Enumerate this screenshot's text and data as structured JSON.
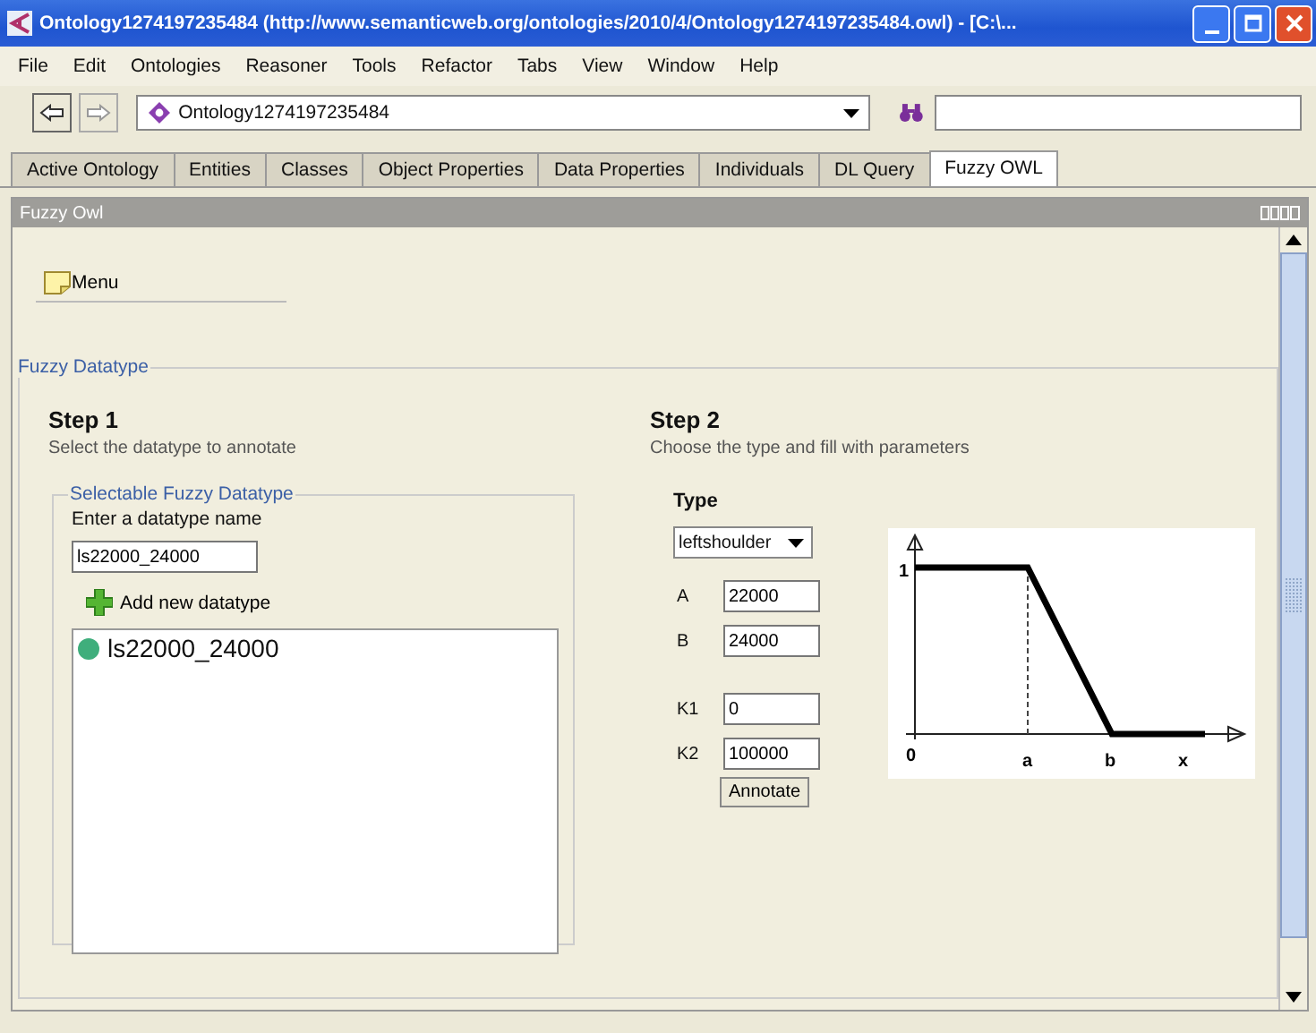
{
  "window": {
    "title": "Ontology1274197235484 (http://www.semanticweb.org/ontologies/2010/4/Ontology1274197235484.owl) - [C:\\..."
  },
  "menu_bar": [
    "File",
    "Edit",
    "Ontologies",
    "Reasoner",
    "Tools",
    "Refactor",
    "Tabs",
    "View",
    "Window",
    "Help"
  ],
  "toolbar": {
    "ontology": "Ontology1274197235484"
  },
  "tabs": [
    {
      "label": "Active Ontology",
      "selected": false
    },
    {
      "label": "Entities",
      "selected": false
    },
    {
      "label": "Classes",
      "selected": false
    },
    {
      "label": "Object Properties",
      "selected": false
    },
    {
      "label": "Data Properties",
      "selected": false
    },
    {
      "label": "Individuals",
      "selected": false
    },
    {
      "label": "DL Query",
      "selected": false
    },
    {
      "label": "Fuzzy OWL",
      "selected": true
    }
  ],
  "view": {
    "title": "Fuzzy Owl",
    "menu_button": "Menu",
    "group": "Fuzzy Datatype",
    "step1": {
      "heading": "Step 1",
      "hint": "Select the datatype to annotate",
      "box_title": "Selectable Fuzzy Datatype",
      "field_label": "Enter a datatype name",
      "name_value": "ls22000_24000",
      "add_button": "Add new datatype",
      "datatypes": [
        "ls22000_24000"
      ]
    },
    "step2": {
      "heading": "Step 2",
      "hint": "Choose the type and fill with parameters",
      "type_label": "Type",
      "type_value": "leftshoulder",
      "bounds": [
        {
          "label": "A",
          "value": "22000"
        },
        {
          "label": "B",
          "value": "24000"
        }
      ],
      "limits": [
        {
          "label": "K1",
          "value": "0"
        },
        {
          "label": "K2",
          "value": "100000"
        }
      ],
      "annotate": "Annotate",
      "graph_labels": {
        "one": "1",
        "zero": "0",
        "a": "a",
        "b": "b",
        "x": "x"
      }
    }
  }
}
